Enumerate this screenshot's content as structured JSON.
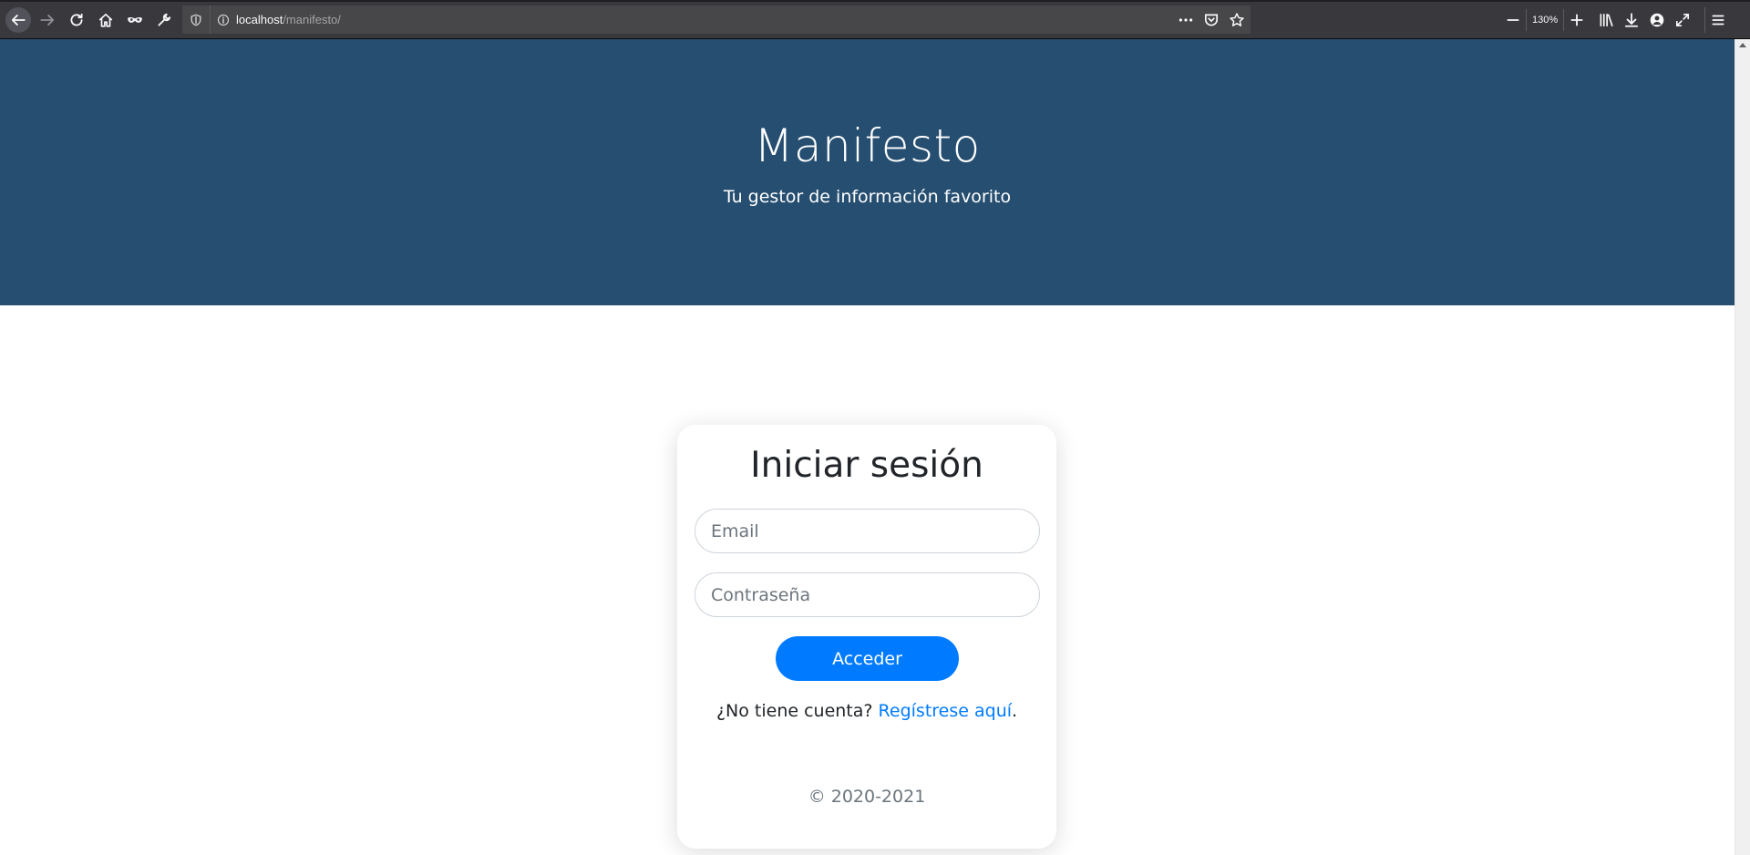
{
  "browser": {
    "url_host": "localhost",
    "url_path": "/manifesto/",
    "zoom": "130%"
  },
  "hero": {
    "title": "Manifesto",
    "subtitle": "Tu gestor de información favorito",
    "background_color": "#264e70"
  },
  "login": {
    "heading": "Iniciar sesión",
    "email_placeholder": "Email",
    "password_placeholder": "Contraseña",
    "submit_label": "Acceder",
    "no_account_text": "¿No tiene cuenta?",
    "register_link": "Regístrese aquí",
    "register_suffix": ".",
    "copyright": "© 2020-2021",
    "accent_color": "#007bff"
  },
  "icons": {
    "back": "arrow-left-icon",
    "forward": "arrow-right-icon",
    "reload": "reload-icon",
    "home": "home-icon",
    "private": "mask-icon",
    "tools": "wrench-icon",
    "tracking": "shield-icon",
    "info": "info-icon",
    "page_actions": "more-dots-icon",
    "pocket": "pocket-icon",
    "bookmark": "star-icon",
    "zoom_out": "minus-icon",
    "zoom_in": "plus-icon",
    "library": "library-icon",
    "downloads": "download-icon",
    "account": "account-icon",
    "fullscreen": "expand-icon",
    "menu": "hamburger-menu-icon"
  }
}
